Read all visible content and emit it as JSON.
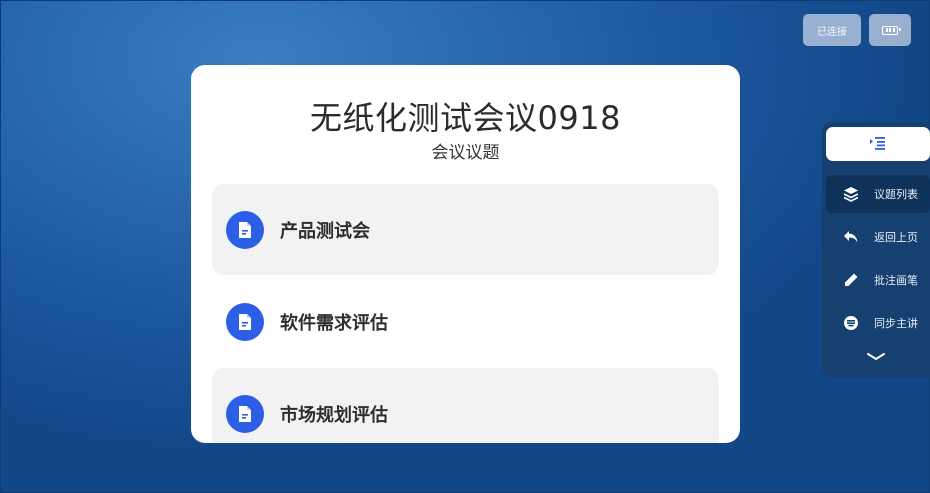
{
  "header": {
    "connection_label": "已连接",
    "battery_icon": "battery-icon"
  },
  "meeting": {
    "title": "无纸化测试会议0918",
    "subtitle": "会议议题"
  },
  "topics": [
    {
      "label": "产品测试会",
      "icon": "document-icon",
      "shaded": true
    },
    {
      "label": "软件需求评估",
      "icon": "document-icon",
      "shaded": false
    },
    {
      "label": "市场规划评估",
      "icon": "document-icon",
      "shaded": true
    }
  ],
  "toolbar": {
    "collapse_icon": "menu-collapse-icon",
    "items": [
      {
        "label": "议题列表",
        "icon": "layers-icon",
        "active": true
      },
      {
        "label": "返回上页",
        "icon": "back-arrow-icon",
        "active": false
      },
      {
        "label": "批注画笔",
        "icon": "pen-icon",
        "active": false
      },
      {
        "label": "同步主讲",
        "icon": "sync-icon",
        "active": false
      }
    ],
    "more_icon": "chevron-down-icon"
  },
  "colors": {
    "accent": "#2c5fe6",
    "toolbar_bg": "#15406f",
    "card_bg": "#ffffff"
  }
}
